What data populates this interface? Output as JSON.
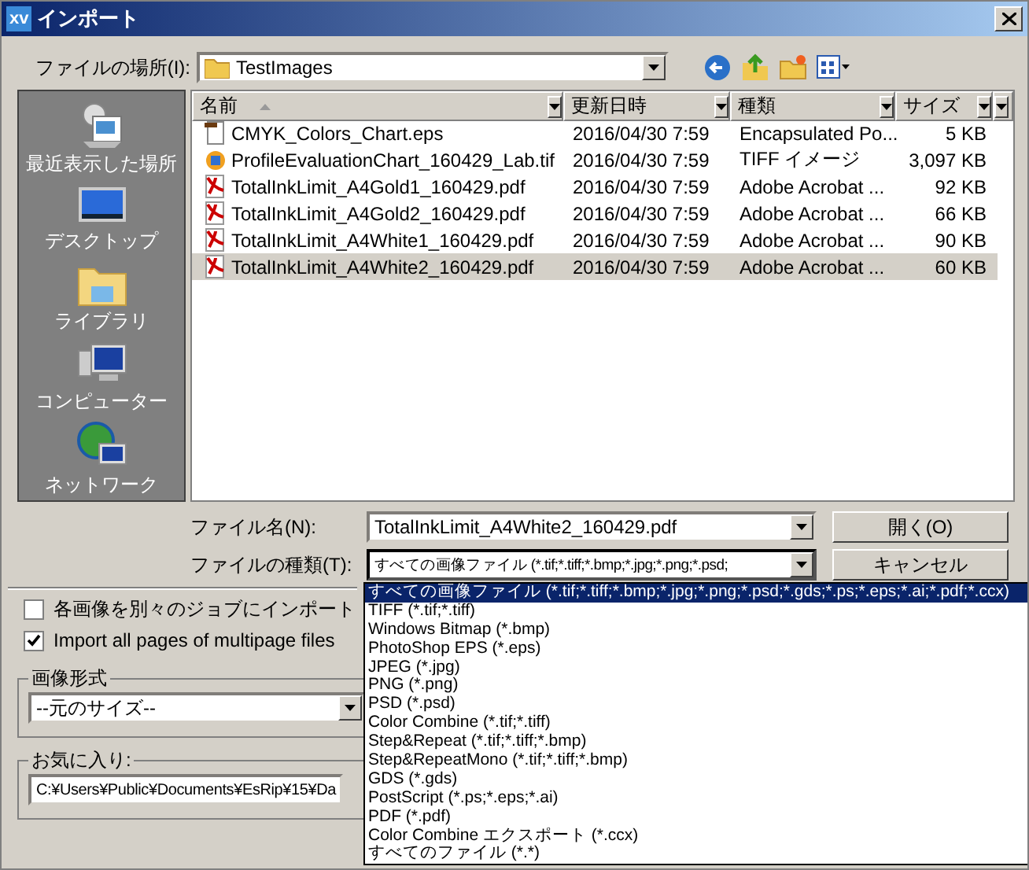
{
  "window": {
    "logo_text": "xv",
    "title": "インポート"
  },
  "location": {
    "label": "ファイルの場所(I):",
    "value": "TestImages"
  },
  "places": [
    {
      "kind": "recent",
      "label": "最近表示した場所"
    },
    {
      "kind": "desktop",
      "label": "デスクトップ"
    },
    {
      "kind": "library",
      "label": "ライブラリ"
    },
    {
      "kind": "computer",
      "label": "コンピューター"
    },
    {
      "kind": "network",
      "label": "ネットワーク"
    }
  ],
  "columns": [
    {
      "label": "名前",
      "sorted": true
    },
    {
      "label": "更新日時",
      "sorted": false
    },
    {
      "label": "種類",
      "sorted": false
    },
    {
      "label": "サイズ",
      "sorted": false
    }
  ],
  "files": [
    {
      "kind": "eps",
      "name": "CMYK_Colors_Chart.eps",
      "modified": "2016/04/30 7:59",
      "type": "Encapsulated Po...",
      "size": "5 KB",
      "selected": false
    },
    {
      "kind": "tif",
      "name": "ProfileEvaluationChart_160429_Lab.tif",
      "modified": "2016/04/30 7:59",
      "type": "TIFF イメージ",
      "size": "3,097 KB",
      "selected": false
    },
    {
      "kind": "pdf",
      "name": "TotalInkLimit_A4Gold1_160429.pdf",
      "modified": "2016/04/30 7:59",
      "type": "Adobe Acrobat ...",
      "size": "92 KB",
      "selected": false
    },
    {
      "kind": "pdf",
      "name": "TotalInkLimit_A4Gold2_160429.pdf",
      "modified": "2016/04/30 7:59",
      "type": "Adobe Acrobat ...",
      "size": "66 KB",
      "selected": false
    },
    {
      "kind": "pdf",
      "name": "TotalInkLimit_A4White1_160429.pdf",
      "modified": "2016/04/30 7:59",
      "type": "Adobe Acrobat ...",
      "size": "90 KB",
      "selected": false
    },
    {
      "kind": "pdf",
      "name": "TotalInkLimit_A4White2_160429.pdf",
      "modified": "2016/04/30 7:59",
      "type": "Adobe Acrobat ...",
      "size": "60 KB",
      "selected": true
    }
  ],
  "filename": {
    "label": "ファイル名(N):",
    "value": "TotalInkLimit_A4White2_160429.pdf"
  },
  "filetype": {
    "label": "ファイルの種類(T):",
    "value": "すべての画像ファイル (*.tif;*.tiff;*.bmp;*.jpg;*.png;*.psd;",
    "expanded": true
  },
  "buttons": [
    {
      "label": "開く(O)"
    },
    {
      "label": "キャンセル"
    }
  ],
  "options": [
    {
      "label": "各画像を別々のジョブにインポート",
      "checked": false
    },
    {
      "label": "Import all pages of multipage files",
      "checked": true
    }
  ],
  "image_format": {
    "title": "画像形式",
    "value": "--元のサイズ--"
  },
  "favorites": {
    "title": "お気に入り:",
    "value": "C:¥Users¥Public¥Documents¥EsRip¥15¥Da"
  },
  "filetype_options": [
    {
      "label": "すべての画像ファイル (*.tif;*.tiff;*.bmp;*.jpg;*.png;*.psd;*.gds;*.ps;*.eps;*.ai;*.pdf;*.ccx)",
      "selected": true
    },
    {
      "label": "TIFF (*.tif;*.tiff)",
      "selected": false
    },
    {
      "label": "Windows Bitmap (*.bmp)",
      "selected": false
    },
    {
      "label": "PhotoShop EPS (*.eps)",
      "selected": false
    },
    {
      "label": "JPEG (*.jpg)",
      "selected": false
    },
    {
      "label": "PNG (*.png)",
      "selected": false
    },
    {
      "label": "PSD (*.psd)",
      "selected": false
    },
    {
      "label": "Color Combine (*.tif;*.tiff)",
      "selected": false
    },
    {
      "label": "Step&Repeat (*.tif;*.tiff;*.bmp)",
      "selected": false
    },
    {
      "label": "Step&RepeatMono (*.tif;*.tiff;*.bmp)",
      "selected": false
    },
    {
      "label": "GDS (*.gds)",
      "selected": false
    },
    {
      "label": "PostScript (*.ps;*.eps;*.ai)",
      "selected": false
    },
    {
      "label": "PDF (*.pdf)",
      "selected": false
    },
    {
      "label": "Color Combine エクスポート (*.ccx)",
      "selected": false
    },
    {
      "label": "すべてのファイル (*.*)",
      "selected": false
    }
  ]
}
